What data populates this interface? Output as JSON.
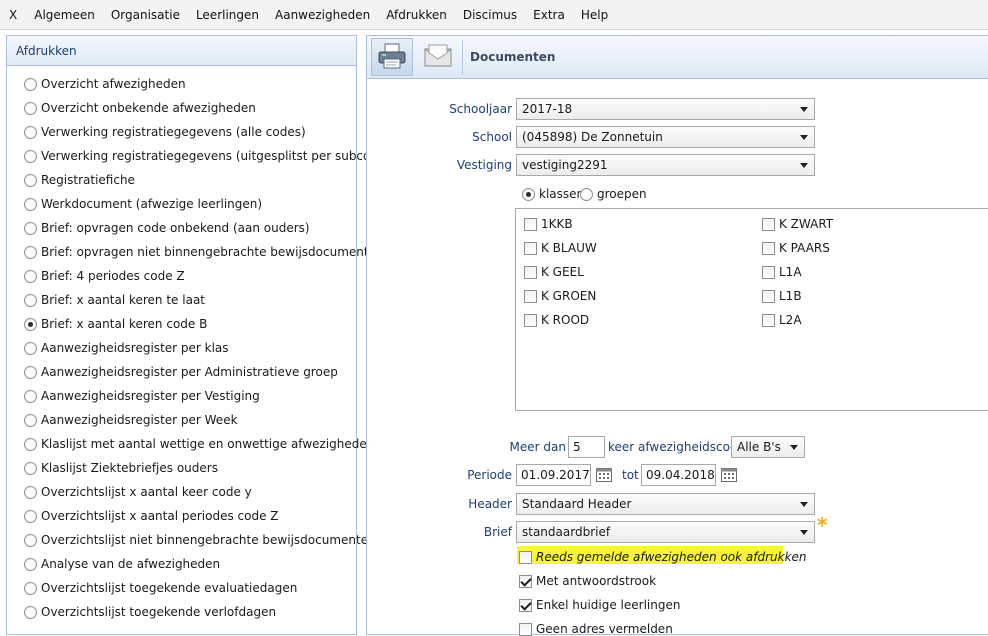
{
  "menu": {
    "close_label": "X",
    "items": [
      "Algemeen",
      "Organisatie",
      "Leerlingen",
      "Aanwezigheden",
      "Afdrukken",
      "Discimus",
      "Extra",
      "Help"
    ]
  },
  "left_panel": {
    "title": "Afdrukken",
    "selected_index": 10,
    "options": [
      "Overzicht afwezigheden",
      "Overzicht onbekende afwezigheden",
      "Verwerking registratiegegevens (alle codes)",
      "Verwerking registratiegegevens (uitgesplitst per subcode)",
      "Registratiefiche",
      "Werkdocument (afwezige leerlingen)",
      "Brief: opvragen code onbekend (aan ouders)",
      "Brief: opvragen niet binnengebrachte bewijsdocumenten",
      "Brief: 4 periodes code Z",
      "Brief: x aantal keren te laat",
      "Brief: x aantal keren code B",
      "Aanwezigheidsregister per klas",
      "Aanwezigheidsregister per Administratieve groep",
      "Aanwezigheidsregister per Vestiging",
      "Aanwezigheidsregister per Week",
      "Klaslijst met aantal wettige en onwettige afwezigheden",
      "Klaslijst Ziektebriefjes ouders",
      "Overzichtslijst x aantal keer code y",
      "Overzichtslijst x aantal periodes code Z",
      "Overzichtslijst niet binnengebrachte bewijsdocumenten",
      "Analyse van de afwezigheden",
      "Overzichtslijst toegekende evaluatiedagen",
      "Overzichtslijst toegekende verlofdagen"
    ]
  },
  "toolbar": {
    "print_icon": "printer-icon",
    "mail_icon": "envelope-icon",
    "title": "Documenten"
  },
  "form": {
    "schooljaar_label": "Schooljaar",
    "schooljaar_value": "2017-18",
    "school_label": "School",
    "school_value": "(045898) De Zonnetuin",
    "vestiging_label": "Vestiging",
    "vestiging_value": "vestiging2291",
    "radio_klassen": "klassen",
    "radio_groepen": "groepen",
    "classes_col1": [
      {
        "label": "1KKB",
        "checked": false
      },
      {
        "label": "K BLAUW",
        "checked": false
      },
      {
        "label": "K GEEL",
        "checked": false
      },
      {
        "label": "K GROEN",
        "checked": false
      },
      {
        "label": "K ROOD",
        "checked": false
      }
    ],
    "classes_col2": [
      {
        "label": "K ZWART",
        "checked": false
      },
      {
        "label": "K PAARS",
        "checked": false
      },
      {
        "label": "L1A",
        "checked": false
      },
      {
        "label": "L1B",
        "checked": false
      },
      {
        "label": "L2A",
        "checked": false
      }
    ],
    "meer_dan_label": "Meer dan",
    "meer_dan_value": "5",
    "keer_label": "keer afwezigheidscode",
    "code_value": "Alle B's",
    "periode_label": "Periode",
    "periode_from": "01.09.2017",
    "tot_label": "tot",
    "periode_to": "09.04.2018",
    "header_label": "Header",
    "header_value": "Standaard Header",
    "brief_label": "Brief",
    "brief_value": "standaardbrief",
    "required_marker": "*",
    "options": [
      {
        "label": "Reeds gemelde afwezigheden ook afdrukken",
        "checked": false,
        "highlight": true
      },
      {
        "label": "Met antwoordstrook",
        "checked": true
      },
      {
        "label": "Enkel huidige leerlingen",
        "checked": true
      },
      {
        "label": "Geen adres vermelden",
        "checked": false
      }
    ]
  },
  "colors": {
    "label_blue": "#1d3f73",
    "panel_border": "#aac0dc",
    "highlight_yellow": "#f7f43a",
    "required_orange": "#f2a51e"
  }
}
